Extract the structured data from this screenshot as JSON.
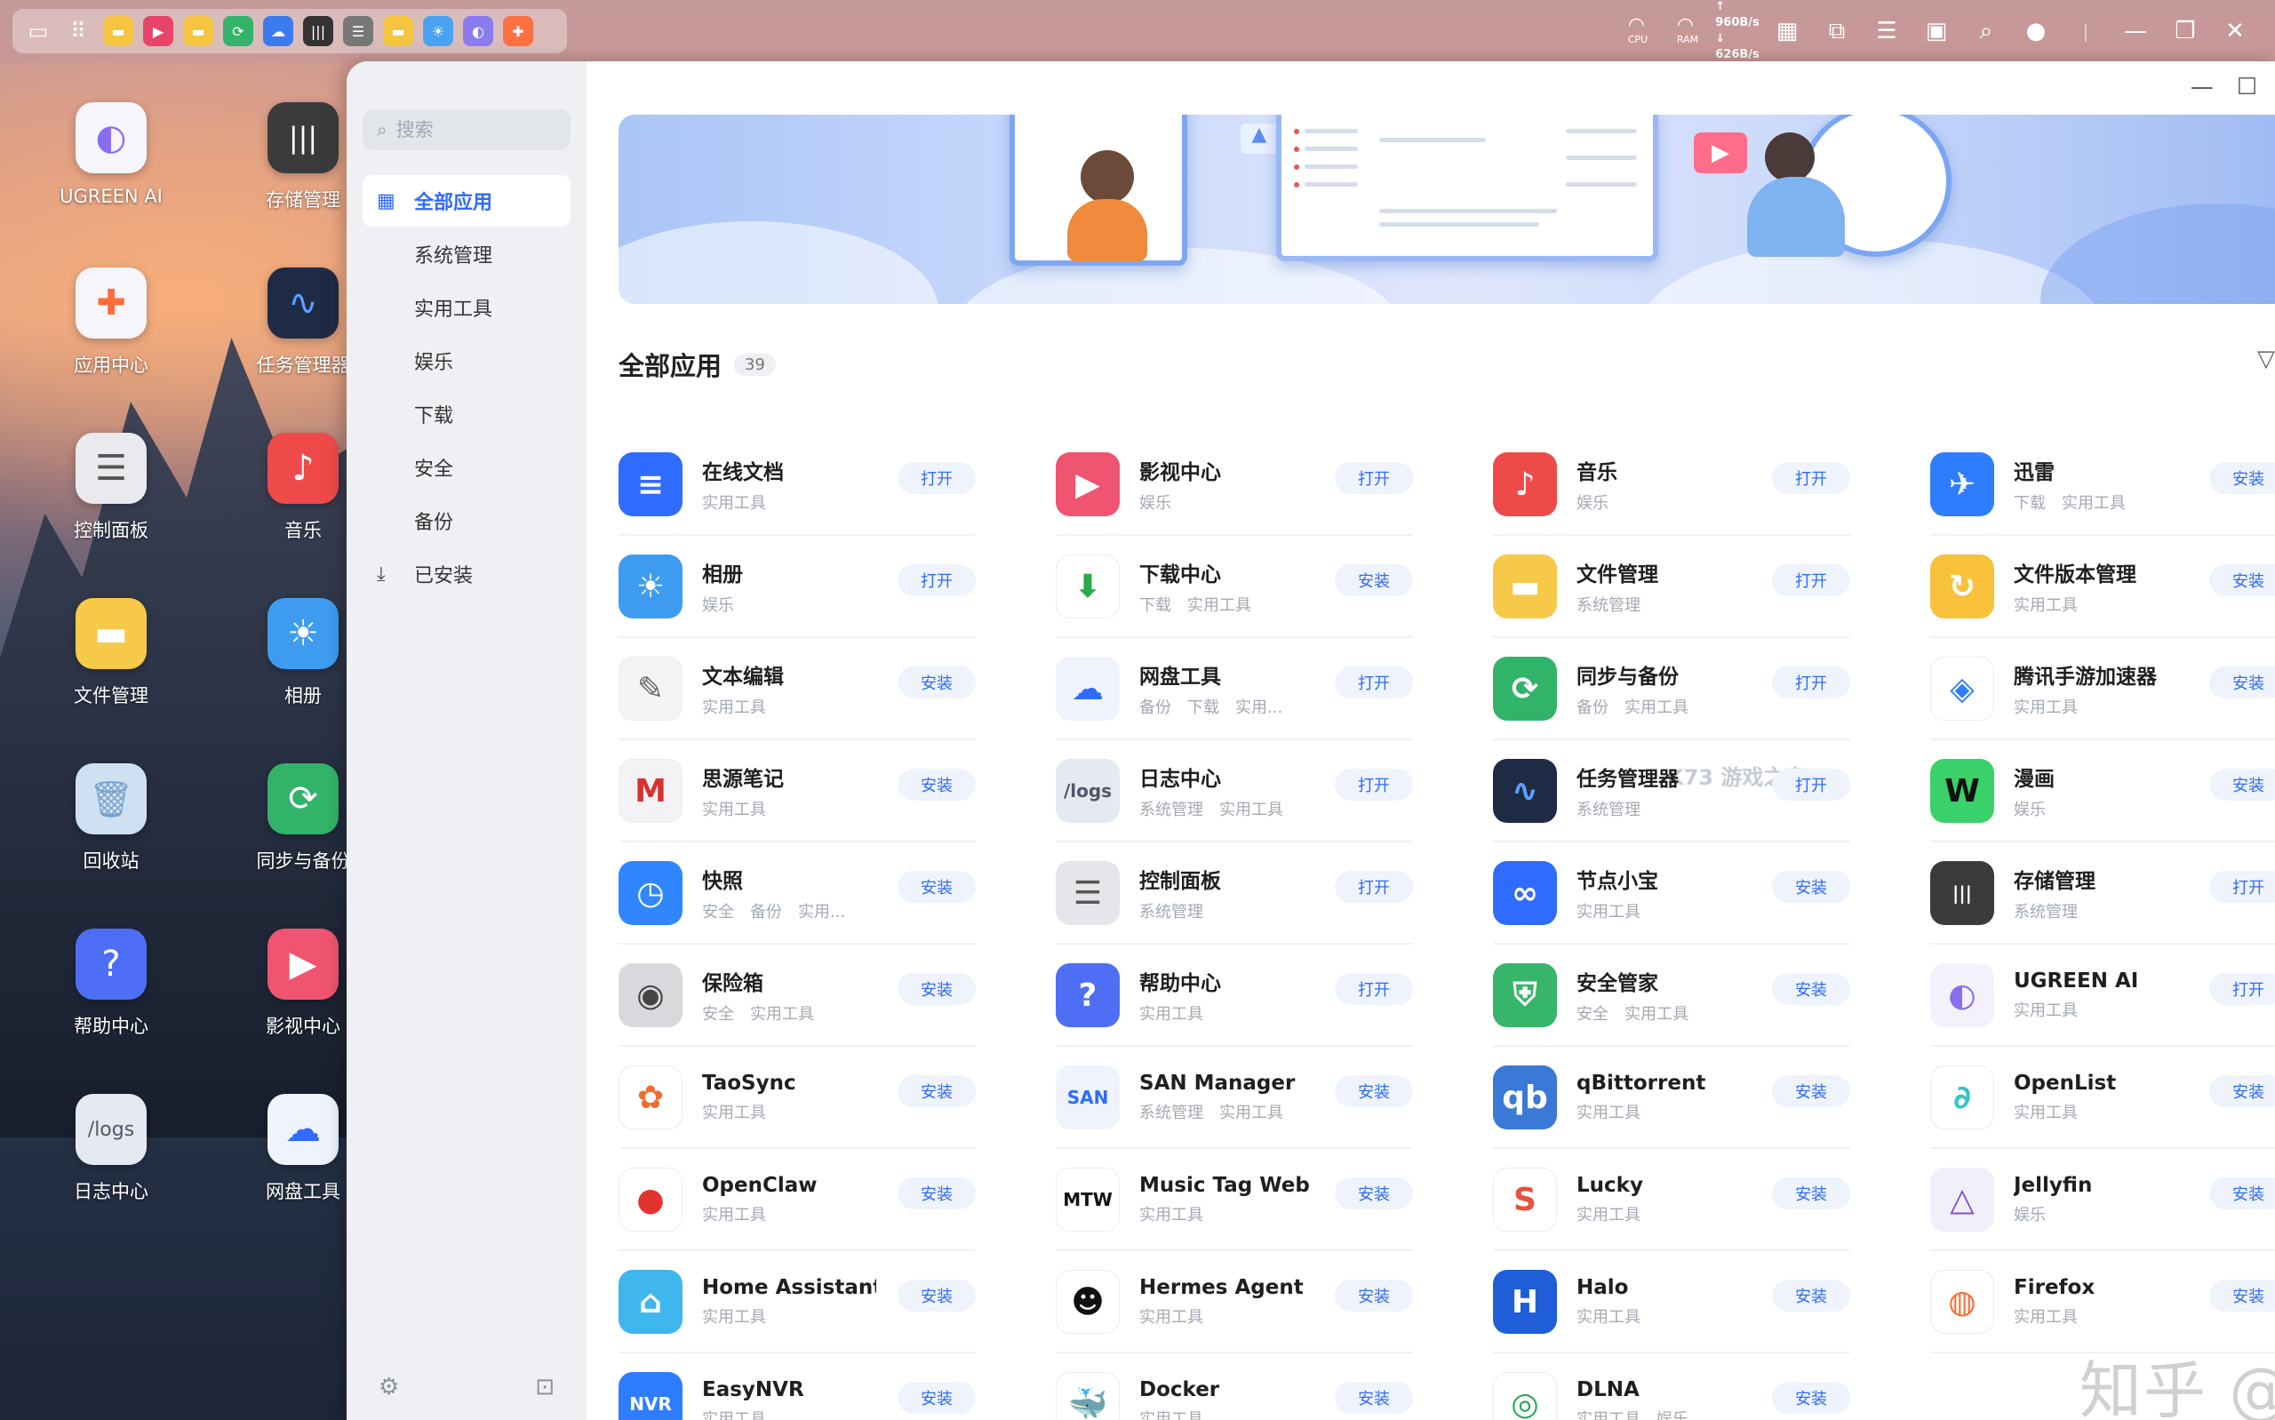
{
  "colors": {
    "accent": "#2f6bff",
    "button_bg": "#eff3fb",
    "sidebar_bg": "#eef0f4"
  },
  "topbar": {
    "dock_apps": [
      {
        "icon": "folder-icon",
        "color": "#f5c542"
      },
      {
        "icon": "video-icon",
        "color": "#e8446a"
      },
      {
        "icon": "folder-icon",
        "color": "#f5c542"
      },
      {
        "icon": "sync-icon",
        "color": "#34b36b"
      },
      {
        "icon": "cloud-drive-icon",
        "color": "#3a7cf0"
      },
      {
        "icon": "storage-icon",
        "color": "#333333"
      },
      {
        "icon": "control-panel-icon",
        "color": "#777777"
      },
      {
        "icon": "folder-icon",
        "color": "#f5c542"
      },
      {
        "icon": "photos-icon",
        "color": "#4aa3f0"
      },
      {
        "icon": "ugreen-ai-icon",
        "color": "#8a7cf0"
      },
      {
        "icon": "app-center-icon",
        "color": "#ff7043"
      }
    ],
    "cpu_label": "CPU",
    "ram_label": "RAM",
    "upload_speed": "↑ 960B/s",
    "download_speed": "↓ 626B/s"
  },
  "desktop_icons": [
    {
      "label": "UGREEN AI",
      "icon": "ugreen-ai-icon",
      "color": "#f5f5fb"
    },
    {
      "label": "存储管理",
      "icon": "storage-icon",
      "color": "#3b3b3b"
    },
    {
      "label": "应用中心",
      "icon": "app-center-icon",
      "color": "#f5f5fb"
    },
    {
      "label": "任务管理器",
      "icon": "task-manager-icon",
      "color": "#1f2b44"
    },
    {
      "label": "控制面板",
      "icon": "control-panel-icon",
      "color": "#e9e9ee"
    },
    {
      "label": "音乐",
      "icon": "music-icon",
      "color": "#ef4a4a"
    },
    {
      "label": "文件管理",
      "icon": "folder-icon",
      "color": "#f7c948"
    },
    {
      "label": "相册",
      "icon": "photos-icon",
      "color": "#3e9cf0"
    },
    {
      "label": "回收站",
      "icon": "trash-icon",
      "color": "#cfe0f2"
    },
    {
      "label": "同步与备份",
      "icon": "sync-icon",
      "color": "#32b36a"
    },
    {
      "label": "帮助中心",
      "icon": "help-icon",
      "color": "#4d6ef5"
    },
    {
      "label": "影视中心",
      "icon": "video-icon",
      "color": "#ef5470"
    },
    {
      "label": "日志中心",
      "icon": "logs-icon",
      "color": "#e6e9f2"
    },
    {
      "label": "网盘工具",
      "icon": "cloud-drive-icon",
      "color": "#eef3fc"
    }
  ],
  "sidebar": {
    "search_placeholder": "搜索",
    "items": [
      {
        "label": "全部应用",
        "active": true
      },
      {
        "label": "系统管理"
      },
      {
        "label": "实用工具"
      },
      {
        "label": "娱乐"
      },
      {
        "label": "下载"
      },
      {
        "label": "安全"
      },
      {
        "label": "备份"
      },
      {
        "label": "已安装"
      }
    ]
  },
  "main": {
    "section_title": "全部应用",
    "count": "39",
    "apps": [
      {
        "name": "在线文档",
        "tags": [
          "实用工具"
        ],
        "button": "打开",
        "icon": "document-icon",
        "color": "#2f6bff",
        "glyph": "≡"
      },
      {
        "name": "影视中心",
        "tags": [
          "娱乐"
        ],
        "button": "打开",
        "icon": "video-icon",
        "color": "#ef5470",
        "glyph": "▶"
      },
      {
        "name": "音乐",
        "tags": [
          "娱乐"
        ],
        "button": "打开",
        "icon": "music-icon",
        "color": "#ef4a4a",
        "glyph": "♪"
      },
      {
        "name": "迅雷",
        "tags": [
          "下载",
          "实用工具"
        ],
        "button": "安装",
        "icon": "thunder-icon",
        "color": "#2f7dff",
        "glyph": "✈"
      },
      {
        "name": "相册",
        "tags": [
          "娱乐"
        ],
        "button": "打开",
        "icon": "photos-icon",
        "color": "#3e9cf0",
        "glyph": "☀"
      },
      {
        "name": "下载中心",
        "tags": [
          "下载",
          "实用工具"
        ],
        "button": "安装",
        "icon": "download-icon",
        "color": "#ffffff",
        "glyph": "⬇",
        "glyph_color": "#2aaa4a"
      },
      {
        "name": "文件管理",
        "tags": [
          "系统管理"
        ],
        "button": "打开",
        "icon": "folder-icon",
        "color": "#f7c948",
        "glyph": "▬"
      },
      {
        "name": "文件版本管理",
        "tags": [
          "实用工具"
        ],
        "button": "安装",
        "icon": "file-version-icon",
        "color": "#f8c13a",
        "glyph": "↻"
      },
      {
        "name": "文本编辑",
        "tags": [
          "实用工具"
        ],
        "button": "安装",
        "icon": "text-editor-icon",
        "color": "#f4f4f6",
        "glyph": "✎",
        "glyph_color": "#666666"
      },
      {
        "name": "网盘工具",
        "tags": [
          "备份",
          "下载",
          "实用..."
        ],
        "button": "打开",
        "icon": "cloud-drive-icon",
        "color": "#eef3fc",
        "glyph": "☁",
        "glyph_color": "#2f6bff"
      },
      {
        "name": "同步与备份",
        "tags": [
          "备份",
          "实用工具"
        ],
        "button": "打开",
        "icon": "sync-icon",
        "color": "#32b36a",
        "glyph": "⟳"
      },
      {
        "name": "腾讯手游加速器",
        "tags": [
          "实用工具"
        ],
        "button": "安装",
        "icon": "accelerator-icon",
        "color": "#ffffff",
        "glyph": "◈",
        "glyph_color": "#2f7dff"
      },
      {
        "name": "思源笔记",
        "tags": [
          "实用工具"
        ],
        "button": "安装",
        "icon": "siyuan-icon",
        "color": "#f3f3f5",
        "glyph": "M",
        "glyph_color": "#d8322d"
      },
      {
        "name": "日志中心",
        "tags": [
          "系统管理",
          "实用工具"
        ],
        "button": "打开",
        "icon": "logs-icon",
        "color": "#e6e9f2",
        "glyph": "/logs",
        "glyph_color": "#556"
      },
      {
        "name": "任务管理器",
        "tags": [
          "系统管理"
        ],
        "button": "打开",
        "icon": "task-manager-icon",
        "color": "#1f2b44",
        "glyph": "∿",
        "glyph_color": "#5aa0ff"
      },
      {
        "name": "漫画",
        "tags": [
          "娱乐"
        ],
        "button": "安装",
        "icon": "comic-icon",
        "color": "#3ad06a",
        "glyph": "W",
        "glyph_color": "#111111"
      },
      {
        "name": "快照",
        "tags": [
          "安全",
          "备份",
          "实用..."
        ],
        "button": "安装",
        "icon": "snapshot-icon",
        "color": "#2f86ff",
        "glyph": "◷"
      },
      {
        "name": "控制面板",
        "tags": [
          "系统管理"
        ],
        "button": "打开",
        "icon": "control-panel-icon",
        "color": "#e6e6ea",
        "glyph": "☰",
        "glyph_color": "#555555"
      },
      {
        "name": "节点小宝",
        "tags": [
          "实用工具"
        ],
        "button": "安装",
        "icon": "node-icon",
        "color": "#2f6bff",
        "glyph": "∞"
      },
      {
        "name": "存储管理",
        "tags": [
          "系统管理"
        ],
        "button": "打开",
        "icon": "storage-icon",
        "color": "#3b3b3b",
        "glyph": "|||"
      },
      {
        "name": "保险箱",
        "tags": [
          "安全",
          "实用工具"
        ],
        "button": "安装",
        "icon": "safe-icon",
        "color": "#d9d9dd",
        "glyph": "◉",
        "glyph_color": "#444444"
      },
      {
        "name": "帮助中心",
        "tags": [
          "实用工具"
        ],
        "button": "打开",
        "icon": "help-icon",
        "color": "#4d6ef5",
        "glyph": "?"
      },
      {
        "name": "安全管家",
        "tags": [
          "安全",
          "实用工具"
        ],
        "button": "安装",
        "icon": "shield-icon",
        "color": "#36b56b",
        "glyph": "⛨"
      },
      {
        "name": "UGREEN AI",
        "tags": [
          "实用工具"
        ],
        "button": "打开",
        "icon": "ugreen-ai-icon",
        "color": "#f3f2fb",
        "glyph": "◐",
        "glyph_color": "#8a6cf0"
      },
      {
        "name": "TaoSync",
        "tags": [
          "实用工具"
        ],
        "button": "安装",
        "icon": "taosync-icon",
        "color": "#ffffff",
        "glyph": "✿",
        "glyph_color": "#f06b2e"
      },
      {
        "name": "SAN Manager",
        "tags": [
          "系统管理",
          "实用工具"
        ],
        "button": "安装",
        "icon": "san-icon",
        "color": "#eef3fc",
        "glyph": "SAN",
        "glyph_color": "#2f6bff"
      },
      {
        "name": "qBittorrent",
        "tags": [
          "实用工具"
        ],
        "button": "安装",
        "icon": "qbittorrent-icon",
        "color": "#3a79d6",
        "glyph": "qb"
      },
      {
        "name": "OpenList",
        "tags": [
          "实用工具"
        ],
        "button": "安装",
        "icon": "openlist-icon",
        "color": "#ffffff",
        "glyph": "∂",
        "glyph_color": "#35c4c9"
      },
      {
        "name": "OpenClaw",
        "tags": [
          "实用工具"
        ],
        "button": "安装",
        "icon": "openclaw-icon",
        "color": "#ffffff",
        "glyph": "●",
        "glyph_color": "#e2332f"
      },
      {
        "name": "Music Tag Web",
        "tags": [
          "实用工具"
        ],
        "button": "安装",
        "icon": "music-tag-icon",
        "color": "#ffffff",
        "glyph": "MTW",
        "glyph_color": "#111111"
      },
      {
        "name": "Lucky",
        "tags": [
          "实用工具"
        ],
        "button": "安装",
        "icon": "lucky-icon",
        "color": "#ffffff",
        "glyph": "S",
        "glyph_color": "#e6533a"
      },
      {
        "name": "Jellyfin",
        "tags": [
          "娱乐"
        ],
        "button": "安装",
        "icon": "jellyfin-icon",
        "color": "#f0f0fa",
        "glyph": "△",
        "glyph_color": "#8a4bd8"
      },
      {
        "name": "Home Assistant",
        "tags": [
          "实用工具"
        ],
        "button": "安装",
        "icon": "home-assistant-icon",
        "color": "#40b6ee",
        "glyph": "⌂"
      },
      {
        "name": "Hermes Agent",
        "tags": [
          "实用工具"
        ],
        "button": "安装",
        "icon": "hermes-icon",
        "color": "#ffffff",
        "glyph": "☻",
        "glyph_color": "#111111"
      },
      {
        "name": "Halo",
        "tags": [
          "实用工具"
        ],
        "button": "安装",
        "icon": "halo-icon",
        "color": "#1f5ed8",
        "glyph": "H"
      },
      {
        "name": "Firefox",
        "tags": [
          "实用工具"
        ],
        "button": "安装",
        "icon": "firefox-icon",
        "color": "#ffffff",
        "glyph": "◍",
        "glyph_color": "#ff6a2b"
      },
      {
        "name": "EasyNVR",
        "tags": [
          "实用工具"
        ],
        "button": "安装",
        "icon": "easynvr-icon",
        "color": "#2f7dff",
        "glyph": "NVR"
      },
      {
        "name": "Docker",
        "tags": [
          "实用工具"
        ],
        "button": "安装",
        "icon": "docker-icon",
        "color": "#ffffff",
        "glyph": "🐳",
        "glyph_color": "#2496ed"
      },
      {
        "name": "DLNA",
        "tags": [
          "实用工具",
          "娱乐"
        ],
        "button": "安装",
        "icon": "dlna-icon",
        "color": "#ffffff",
        "glyph": "◎",
        "glyph_color": "#2aa656"
      },
      {
        "name": "",
        "tags": [],
        "button": "",
        "icon": "",
        "color": "",
        "glyph": ""
      }
    ]
  },
  "watermark": "知乎 @演奇",
  "banner_watermark": "K73 游戏之家"
}
